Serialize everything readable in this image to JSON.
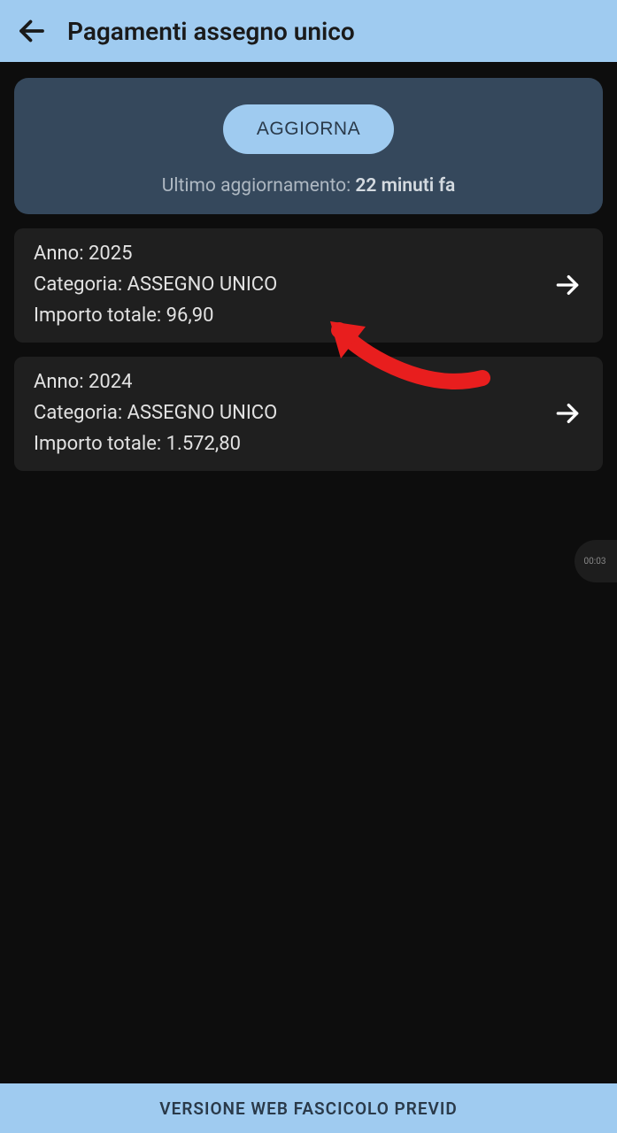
{
  "header": {
    "title": "Pagamenti assegno unico"
  },
  "update": {
    "button_label": "AGGIORNA",
    "info_prefix": "Ultimo aggiornamento: ",
    "time_ago": "22 minuti fa"
  },
  "labels": {
    "anno": "Anno: ",
    "categoria": "Categoria: ",
    "importo_totale": "Importo totale: "
  },
  "items": [
    {
      "anno": "2025",
      "categoria": "ASSEGNO UNICO",
      "importo_totale": "96,90"
    },
    {
      "anno": "2024",
      "categoria": "ASSEGNO UNICO",
      "importo_totale": "1.572,80"
    }
  ],
  "footer": {
    "label": "VERSIONE WEB FASCICOLO PREVID"
  },
  "badge": {
    "time": "00:03"
  }
}
